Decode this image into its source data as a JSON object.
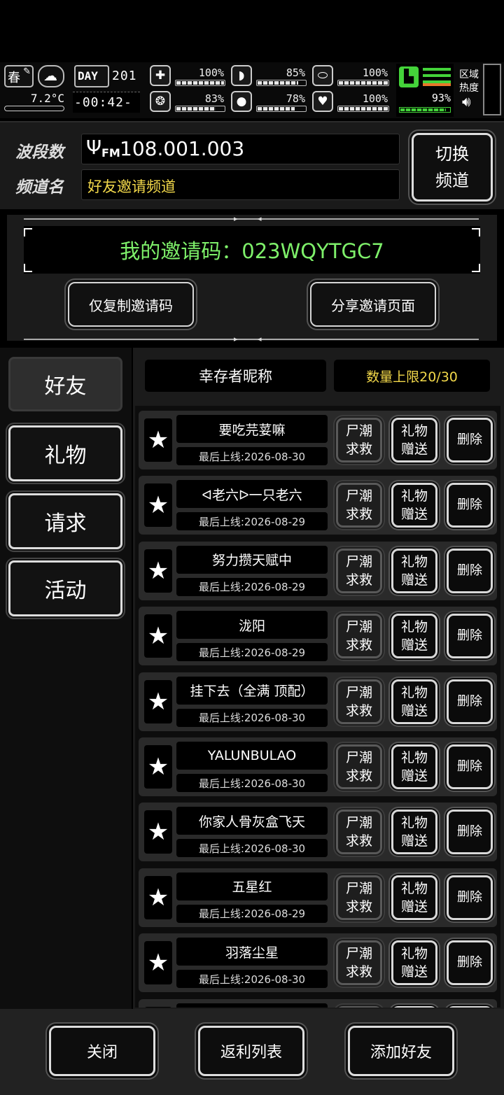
{
  "status": {
    "season": "春",
    "temperature": "7.2°C",
    "day_label": "DAY",
    "day_value": "201",
    "time": "-00:42-",
    "stats": [
      {
        "icon": "medkit-icon",
        "glyph": "✚",
        "value": "100%",
        "level": 1.0
      },
      {
        "icon": "stomach-icon",
        "glyph": "◗",
        "value": "85%",
        "level": 0.85
      },
      {
        "icon": "pill-icon",
        "glyph": "⬭",
        "value": "100%",
        "level": 1.0
      },
      {
        "icon": "brain-icon",
        "glyph": "❂",
        "value": "83%",
        "level": 0.83
      },
      {
        "icon": "water-drop-icon",
        "glyph": "💧",
        "value": "78%",
        "level": 0.78
      },
      {
        "icon": "heart-icon",
        "glyph": "♥",
        "value": "100%",
        "level": 1.0
      }
    ],
    "stamina": {
      "icon": "boot-icon",
      "value": "93%",
      "level": 0.93
    },
    "zone_heat": "区域\n热度",
    "colors": {
      "green": "#44d33a",
      "orange": "#e8762a"
    }
  },
  "channel": {
    "band_label": "波段数",
    "band_prefix": "FM",
    "band_value": "108.001.003",
    "name_label": "频道名",
    "name_value": "好友邀请频道",
    "switch_button": "切换\n频道"
  },
  "invite": {
    "code_text": "我的邀请码：023WQYTGC7",
    "copy_button": "仅复制邀请码",
    "share_button": "分享邀请页面"
  },
  "tabs": [
    {
      "label": "好友",
      "active": true
    },
    {
      "label": "礼物",
      "active": false
    },
    {
      "label": "请求",
      "active": false
    },
    {
      "label": "活动",
      "active": false
    }
  ],
  "list_header": {
    "nickname_col": "幸存者昵称",
    "limit": "数量上限20/30"
  },
  "row_buttons": {
    "zombie_help": "尸潮\n求救",
    "gift": "礼物\n赠送",
    "delete": "删除"
  },
  "friends": [
    {
      "name": "要吃芫荽嘛",
      "last_online": "最后上线:2026-08-30"
    },
    {
      "name": "ᐊ老六ᐅ一只老六",
      "last_online": "最后上线:2026-08-29"
    },
    {
      "name": "努力攒天赋中",
      "last_online": "最后上线:2026-08-29"
    },
    {
      "name": "泷阳",
      "last_online": "最后上线:2026-08-29"
    },
    {
      "name": "挂下去（全满 顶配）",
      "last_online": "最后上线:2026-08-30"
    },
    {
      "name": "YALUNBULAO",
      "last_online": "最后上线:2026-08-30"
    },
    {
      "name": "你家人骨灰盒飞天",
      "last_online": "最后上线:2026-08-30"
    },
    {
      "name": "五星红",
      "last_online": "最后上线:2026-08-29"
    },
    {
      "name": "羽落尘星",
      "last_online": "最后上线:2026-08-30"
    }
  ],
  "bottom": {
    "close": "关闭",
    "back": "返利列表",
    "add_friend": "添加好友"
  },
  "colors": {
    "accent_green": "#7ef06a",
    "accent_yellow": "#f2d84a"
  }
}
